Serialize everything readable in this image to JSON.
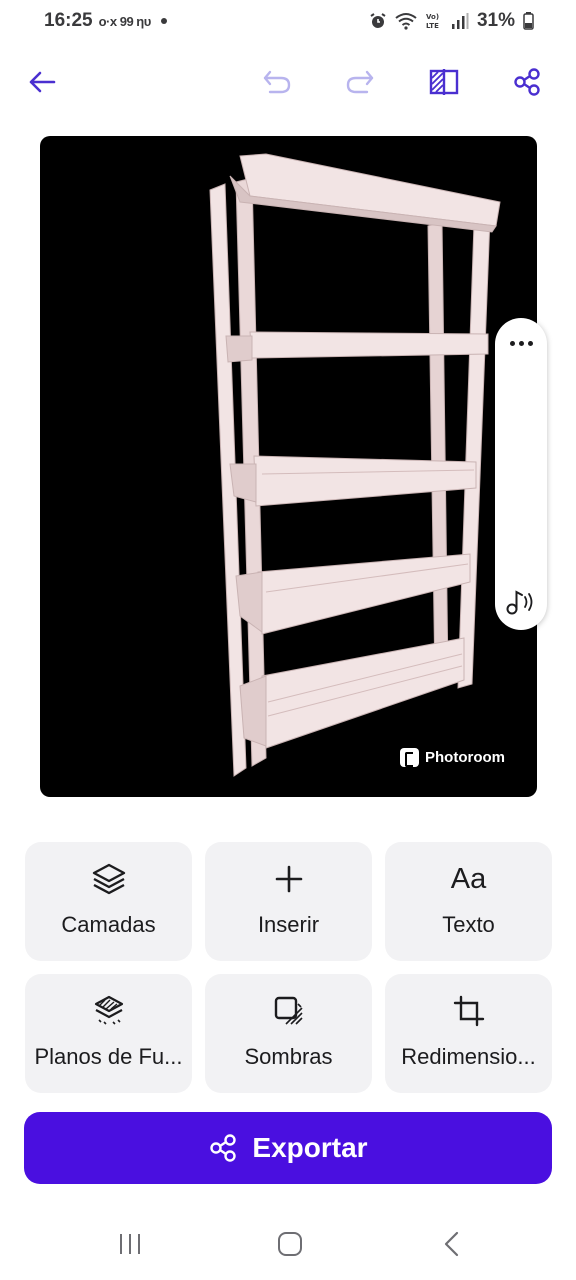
{
  "status_bar": {
    "time": "16:25",
    "notif_icons": "o·x 99 ηυ",
    "battery": "31%"
  },
  "toolbar": {
    "icons": [
      "back-arrow-icon",
      "undo-icon",
      "redo-icon",
      "compare-icon",
      "share-icon"
    ]
  },
  "canvas": {
    "watermark": "Photoroom",
    "background_color": "#000000"
  },
  "tools": [
    {
      "label": "Camadas",
      "icon": "layers-icon"
    },
    {
      "label": "Inserir",
      "icon": "plus-icon"
    },
    {
      "label": "Texto",
      "icon": "text-icon",
      "glyph": "Aa"
    },
    {
      "label": "Planos de Fu...",
      "icon": "backgrounds-icon"
    },
    {
      "label": "Sombras",
      "icon": "shadow-icon"
    },
    {
      "label": "Redimensio...",
      "icon": "crop-icon"
    }
  ],
  "export": {
    "label": "Exportar"
  },
  "colors": {
    "accent": "#4a0fe0",
    "toolbar_icon": "#4a2fd0",
    "tool_bg": "#f2f2f4"
  }
}
